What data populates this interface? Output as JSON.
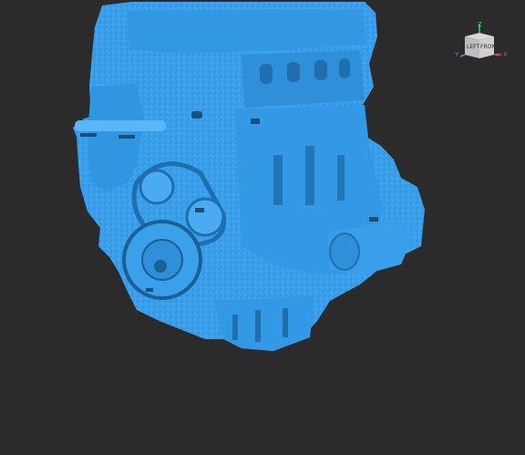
{
  "viewport": {
    "background_color": "#2b2b2b",
    "model_color": "#3aa0ec",
    "model_shadow_color": "#1f6fae",
    "model_highlight_color": "#6cc0ff"
  },
  "nav_cube": {
    "face_left_label": "LEFT",
    "face_front_label": "FRONT",
    "axes": {
      "z": {
        "label": "Z",
        "color": "#3bd16f"
      },
      "x": {
        "label": "X",
        "color": "#e04848"
      },
      "y": {
        "label": "Y",
        "color": "#4a86ff"
      }
    }
  }
}
